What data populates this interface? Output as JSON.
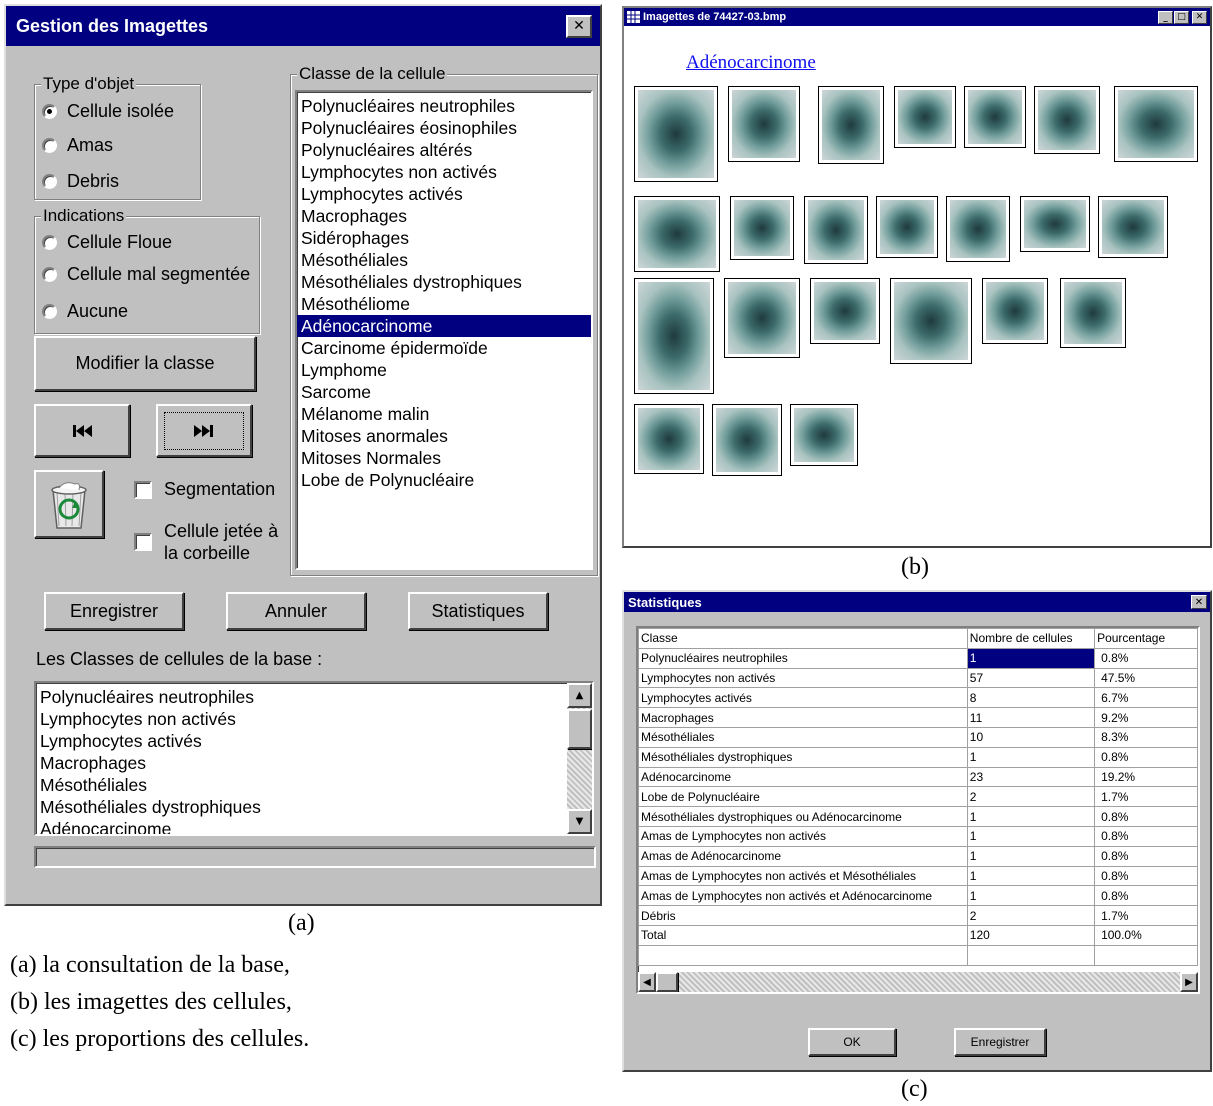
{
  "window_a": {
    "title": "Gestion des Imagettes",
    "close_glyph": "✕",
    "type_objet": {
      "label": "Type d'objet",
      "options": [
        "Cellule isolée",
        "Amas",
        "Debris"
      ],
      "selected": "Cellule isolée"
    },
    "indications": {
      "label": "Indications",
      "options": [
        "Cellule Floue",
        "Cellule mal segmentée",
        "Aucune"
      ]
    },
    "modify_button": "Modifier la classe",
    "prev_icon": "first-icon",
    "next_icon": "last-icon",
    "trash_icon": "recycle-bin-icon",
    "segmentation_label": "Segmentation",
    "discarded_label": "Cellule jetée à la corbeille",
    "classe_group_label": "Classe de la cellule",
    "classes": [
      "Polynucléaires neutrophiles",
      "Polynucléaires éosinophiles",
      "Polynucléaires altérés",
      "Lymphocytes non activés",
      "Lymphocytes activés",
      "Macrophages",
      "Sidérophages",
      "Mésothéliales",
      "Mésothéliales dystrophiques",
      "Mésothéliome",
      "Adénocarcinome",
      "Carcinome épidermoïde",
      "Lymphome",
      "Sarcome",
      "Mélanome malin",
      "Mitoses anormales",
      "Mitoses Normales",
      "Lobe de Polynucléaire"
    ],
    "selected_class": "Adénocarcinome",
    "save_button": "Enregistrer",
    "cancel_button": "Annuler",
    "stats_button": "Statistiques",
    "base_classes_label": "Les Classes de cellules de la base :",
    "base_classes": [
      "Polynucléaires neutrophiles",
      "Lymphocytes non activés",
      "Lymphocytes activés",
      "Macrophages",
      "Mésothéliales",
      "Mésothéliales dystrophiques",
      "Adénocarcinome"
    ]
  },
  "window_b": {
    "title": "Imagettes de 74427-03.bmp",
    "heading_link": "Adénocarcinome",
    "thumbnail_count": 23
  },
  "window_c": {
    "title": "Statistiques",
    "close_glyph": "✕",
    "columns": [
      "Classe",
      "Nombre de cellules",
      "Pourcentage"
    ],
    "rows": [
      [
        "Polynucléaires neutrophiles",
        "1",
        "0.8%"
      ],
      [
        "Lymphocytes non activés",
        "57",
        "47.5%"
      ],
      [
        "Lymphocytes activés",
        "8",
        "6.7%"
      ],
      [
        "Macrophages",
        "11",
        "9.2%"
      ],
      [
        "Mésothéliales",
        "10",
        "8.3%"
      ],
      [
        "Mésothéliales dystrophiques",
        "1",
        "0.8%"
      ],
      [
        "Adénocarcinome",
        "23",
        "19.2%"
      ],
      [
        "Lobe de Polynucléaire",
        "2",
        "1.7%"
      ],
      [
        "Mésothéliales dystrophiques ou Adénocarcinome",
        "1",
        "0.8%"
      ],
      [
        "Amas de Lymphocytes non activés",
        "1",
        "0.8%"
      ],
      [
        "Amas de Adénocarcinome",
        "1",
        "0.8%"
      ],
      [
        "Amas de Lymphocytes non activés et Mésothéliales",
        "1",
        "0.8%"
      ],
      [
        "Amas de Lymphocytes non activés et Adénocarcinome",
        "1",
        "0.8%"
      ],
      [
        "Débris",
        "2",
        "1.7%"
      ],
      [
        "Total",
        "120",
        "100.0%"
      ]
    ],
    "ok_button": "OK",
    "save_button": "Enregistrer"
  },
  "captions": {
    "a": "(a)",
    "b": "(b)",
    "c": "(c)",
    "lines": [
      "(a)  la consultation de la base,",
      "(b)  les imagettes des cellules,",
      "(c)  les proportions des cellules."
    ]
  }
}
